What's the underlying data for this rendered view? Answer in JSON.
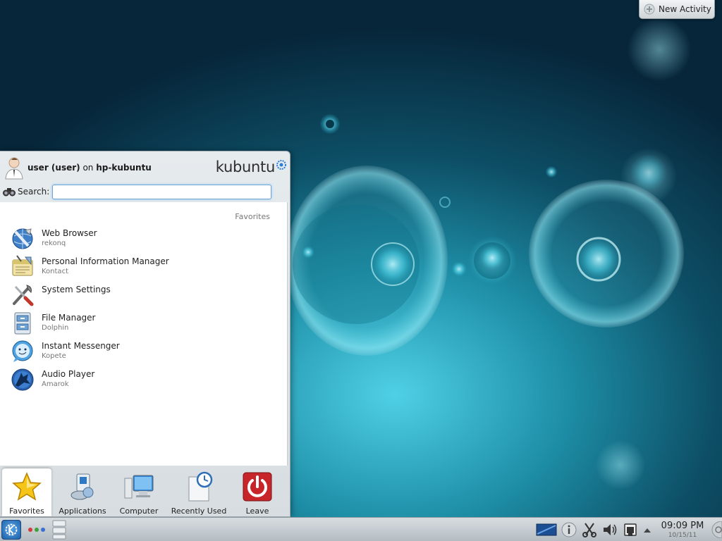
{
  "desktop": {
    "new_activity_label": "New Activity"
  },
  "launcher": {
    "user_prefix": "user (user)",
    "user_on": "on",
    "user_host": "hp-kubuntu",
    "brand": "kubuntu",
    "search_label": "Search:",
    "search_value": "",
    "section_header": "Favorites",
    "favorites": [
      {
        "name": "Web Browser",
        "generic": "rekonq",
        "icon": "web-browser-icon"
      },
      {
        "name": "Personal Information Manager",
        "generic": "Kontact",
        "icon": "pim-icon"
      },
      {
        "name": "System Settings",
        "generic": "",
        "icon": "settings-tools-icon"
      },
      {
        "name": "File Manager",
        "generic": "Dolphin",
        "icon": "file-manager-icon"
      },
      {
        "name": "Instant Messenger",
        "generic": "Kopete",
        "icon": "messenger-icon"
      },
      {
        "name": "Audio Player",
        "generic": "Amarok",
        "icon": "amarok-wolf-icon"
      }
    ],
    "tabs": [
      {
        "label": "Favorites",
        "icon": "star-icon",
        "active": true
      },
      {
        "label": "Applications",
        "icon": "applications-icon",
        "active": false
      },
      {
        "label": "Computer",
        "icon": "computer-icon",
        "active": false
      },
      {
        "label": "Recently Used",
        "icon": "recent-clock-icon",
        "active": false
      },
      {
        "label": "Leave",
        "icon": "power-icon",
        "active": false
      }
    ]
  },
  "panel": {
    "clock_time": "09:09 PM",
    "clock_date": "10/15/11",
    "tray_icons": [
      "desktop-pager-icon",
      "info-icon",
      "scissors-icon",
      "volume-icon",
      "network-icon",
      "expand-arrow-icon"
    ]
  },
  "colors": {
    "wallpaper_accent": "#3fc3dd",
    "leave_red": "#c8252b",
    "star_yellow": "#f5c518"
  }
}
